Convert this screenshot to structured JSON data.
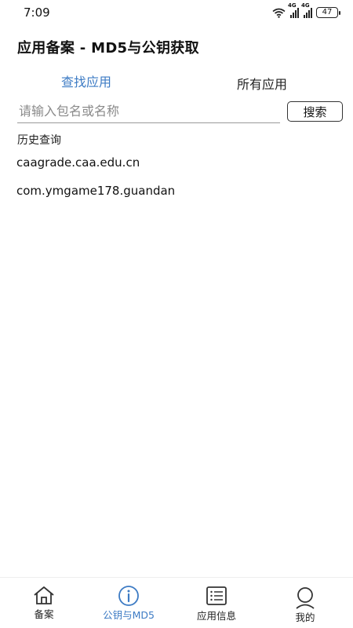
{
  "status_bar": {
    "time": "7:09",
    "network_type_1": "4G",
    "network_type_2": "4G",
    "battery": "47"
  },
  "page": {
    "title": "应用备案 - MD5与公钥获取"
  },
  "tabs": [
    {
      "label": "查找应用",
      "active": true
    },
    {
      "label": "所有应用",
      "active": false
    }
  ],
  "search": {
    "placeholder": "请输入包名或名称",
    "value": "",
    "button_label": "搜索"
  },
  "history": {
    "label": "历史查询",
    "items": [
      "caagrade.caa.edu.cn",
      "com.ymgame178.guandan"
    ]
  },
  "bottom_nav": [
    {
      "label": "备案",
      "icon": "home-icon",
      "active": false
    },
    {
      "label": "公钥与MD5",
      "icon": "info-icon",
      "active": true
    },
    {
      "label": "应用信息",
      "icon": "list-icon",
      "active": false
    },
    {
      "label": "我的",
      "icon": "user-icon",
      "active": false
    }
  ],
  "colors": {
    "accent": "#3d7bc4",
    "text": "#111111",
    "background": "#ffffff"
  }
}
